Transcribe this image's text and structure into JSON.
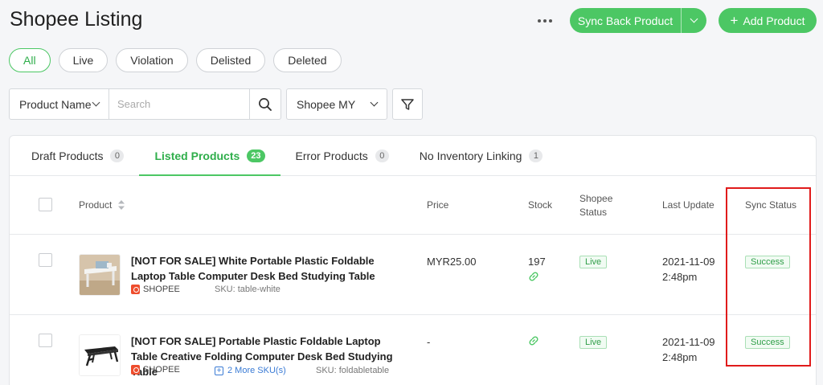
{
  "header": {
    "title": "Shopee Listing",
    "sync_label": "Sync Back Product",
    "add_label": "Add Product"
  },
  "filters": [
    "All",
    "Live",
    "Violation",
    "Delisted",
    "Deleted"
  ],
  "search": {
    "field_label": "Product Name",
    "placeholder": "Search",
    "store_label": "Shopee MY"
  },
  "tabs": [
    {
      "label": "Draft Products",
      "count": "0"
    },
    {
      "label": "Listed Products",
      "count": "23"
    },
    {
      "label": "Error Products",
      "count": "0"
    },
    {
      "label": "No Inventory Linking",
      "count": "1"
    }
  ],
  "columns": {
    "product": "Product",
    "price": "Price",
    "stock": "Stock",
    "shopee_status": "Shopee Status",
    "last_update": "Last Update",
    "sync_status": "Sync Status"
  },
  "rows": [
    {
      "name": "[NOT FOR SALE] White Portable Plastic Foldable Laptop Table Computer Desk Bed Studying Table",
      "shop": "SHOPEE",
      "sku": "SKU: table-white",
      "price": "MYR25.00",
      "stock": "197",
      "status": "Live",
      "date": "2021-11-09",
      "time": "2:48pm",
      "sync": "Success"
    },
    {
      "name": "[NOT FOR SALE] Portable Plastic Foldable Laptop Table Creative Folding Computer Desk Bed Studying Table",
      "shop": "SHOPEE",
      "more_sku": "2 More SKU(s)",
      "sku": "SKU: foldabletable",
      "price": "-",
      "status": "Live",
      "date": "2021-11-09",
      "time": "2:48pm",
      "sync": "Success"
    }
  ],
  "colors": {
    "accent": "#4cc764",
    "highlight": "#e01b1b"
  }
}
